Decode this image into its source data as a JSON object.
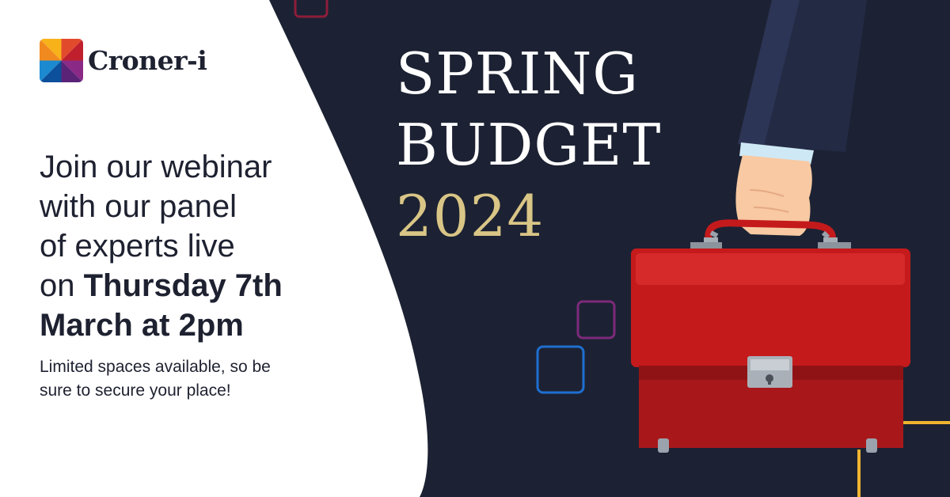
{
  "brand": {
    "name": "Croner-i",
    "logo_colors": [
      "#f39c1f",
      "#e3432b",
      "#0e63b2",
      "#7a2b86"
    ]
  },
  "headline": {
    "line1": "SPRING",
    "line2": "BUDGET",
    "year": "2024"
  },
  "invite": {
    "line1": "Join our webinar",
    "line2": "with our panel",
    "line3": "of experts live",
    "line4_prefix": "on ",
    "line4_date": "Thursday 7th",
    "line5_time": "March at 2pm"
  },
  "subtext": {
    "line1": "Limited spaces available, so be",
    "line2": "sure to secure your place!"
  },
  "colors": {
    "background": "#1c2233",
    "panel": "#ffffff",
    "text_dark": "#1e2130",
    "headline": "#ffffff",
    "year_gold": "#d9c586",
    "briefcase_red": "#c41a1c",
    "accent_yellow": "#f0b330",
    "accent_purple": "#7c2a7a",
    "accent_blue": "#1f6fd0",
    "accent_crimson": "#8c1d3b"
  },
  "icons": [
    "briefcase-illustration",
    "hand-illustration",
    "croner-i-logo-mark"
  ]
}
